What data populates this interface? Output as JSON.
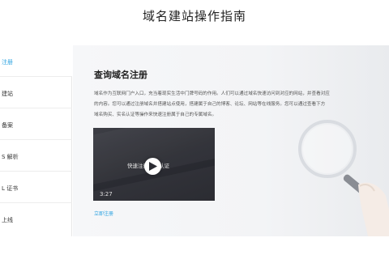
{
  "page": {
    "title": "域名建站操作指南"
  },
  "sidebar": {
    "items": [
      {
        "label": "注册",
        "active": true
      },
      {
        "label": "建站",
        "active": false
      },
      {
        "label": "备案",
        "active": false
      },
      {
        "label": "S 解析",
        "active": false
      },
      {
        "label": "L 证书",
        "active": false
      },
      {
        "label": "上线",
        "active": false
      }
    ]
  },
  "main": {
    "section_title": "查询域名注册",
    "description_lines": [
      "域名作为互联网门户入口，充当着现实生活中门牌号码的作用。人们可以通过域名快速访问到对应的网站，并查看对应",
      "的内容。您可以通过注册域名并搭建站点使用，搭建属于自己的博客、论坛、网站等在线服务。您可以通过查看下方",
      "域名购买、实名认证等操作来快速注册属于自己的专属域名。"
    ],
    "video": {
      "caption": "快速注册域名认证",
      "duration": "3:27"
    },
    "link_label": "立即注册"
  },
  "colors": {
    "accent": "#2aa1e0",
    "content_bg": "#f3f4f6",
    "video_bg": "#2b2c33"
  },
  "icons": {
    "play": "play-icon",
    "decoration": "magnifier-hand-illustration"
  }
}
